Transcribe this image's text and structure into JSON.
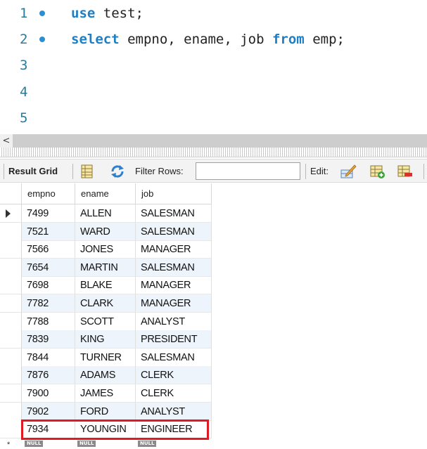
{
  "editor": {
    "lines": [
      {
        "num": "1",
        "has_bullet": true,
        "tokens": [
          {
            "t": "use",
            "kw": true
          },
          {
            "t": " test;",
            "kw": false
          }
        ]
      },
      {
        "num": "2",
        "has_bullet": true,
        "tokens": [
          {
            "t": "select",
            "kw": true
          },
          {
            "t": " empno, ename, job ",
            "kw": false
          },
          {
            "t": "from",
            "kw": true
          },
          {
            "t": " emp;",
            "kw": false
          }
        ]
      },
      {
        "num": "3",
        "has_bullet": false,
        "tokens": []
      },
      {
        "num": "4",
        "has_bullet": false,
        "tokens": []
      },
      {
        "num": "5",
        "has_bullet": false,
        "tokens": []
      }
    ]
  },
  "scrollbar": {
    "left_arrow": "<"
  },
  "toolbar": {
    "result_grid_label": "Result Grid",
    "filter_label": "Filter Rows:",
    "filter_value": "",
    "edit_label": "Edit:"
  },
  "grid": {
    "columns": [
      "empno",
      "ename",
      "job"
    ],
    "rows": [
      [
        "7499",
        "ALLEN",
        "SALESMAN"
      ],
      [
        "7521",
        "WARD",
        "SALESMAN"
      ],
      [
        "7566",
        "JONES",
        "MANAGER"
      ],
      [
        "7654",
        "MARTIN",
        "SALESMAN"
      ],
      [
        "7698",
        "BLAKE",
        "MANAGER"
      ],
      [
        "7782",
        "CLARK",
        "MANAGER"
      ],
      [
        "7788",
        "SCOTT",
        "ANALYST"
      ],
      [
        "7839",
        "KING",
        "PRESIDENT"
      ],
      [
        "7844",
        "TURNER",
        "SALESMAN"
      ],
      [
        "7876",
        "ADAMS",
        "CLERK"
      ],
      [
        "7900",
        "JAMES",
        "CLERK"
      ],
      [
        "7902",
        "FORD",
        "ANALYST"
      ],
      [
        "7934",
        "YOUNGIN",
        "ENGINEER"
      ]
    ],
    "null_label": "NULL",
    "new_row_marker": "*",
    "selected_row_index": 0,
    "highlighted_row_index": 12,
    "highlight_color": "#e01a22",
    "alt_row_color": "#eef4fb"
  },
  "colors": {
    "keyword": "#1e7fc4",
    "line_number": "#2b7a9a",
    "bullet": "#2b8fd0"
  }
}
